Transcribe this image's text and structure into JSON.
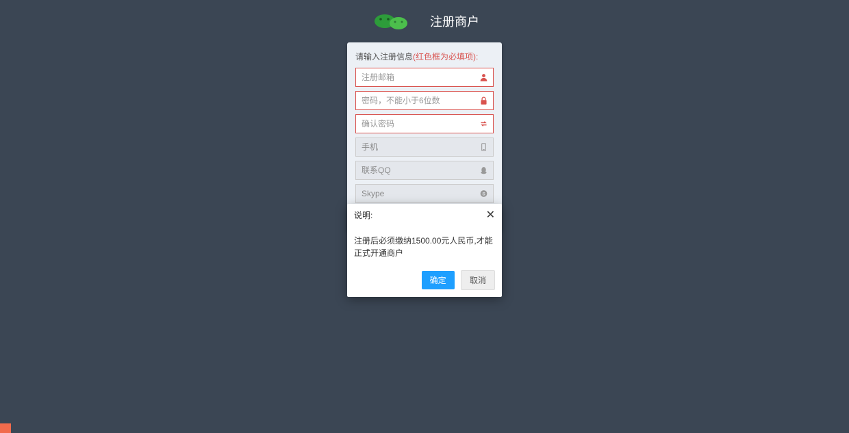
{
  "header": {
    "title": "注册商户"
  },
  "form": {
    "hint_prefix": "请输入注册信息",
    "hint_required": "(红色框为必填项):",
    "fields": {
      "email": {
        "placeholder": "注册邮箱"
      },
      "password": {
        "placeholder": "密码，不能小于6位数"
      },
      "confirm_password": {
        "placeholder": "确认密码"
      },
      "phone": {
        "placeholder": "手机"
      },
      "qq": {
        "placeholder": "联系QQ"
      },
      "skype": {
        "placeholder": "Skype"
      }
    }
  },
  "modal": {
    "title": "说明:",
    "body": "注册后必须缴纳1500.00元人民币,才能正式开通商户",
    "confirm": "确定",
    "cancel": "取消"
  }
}
